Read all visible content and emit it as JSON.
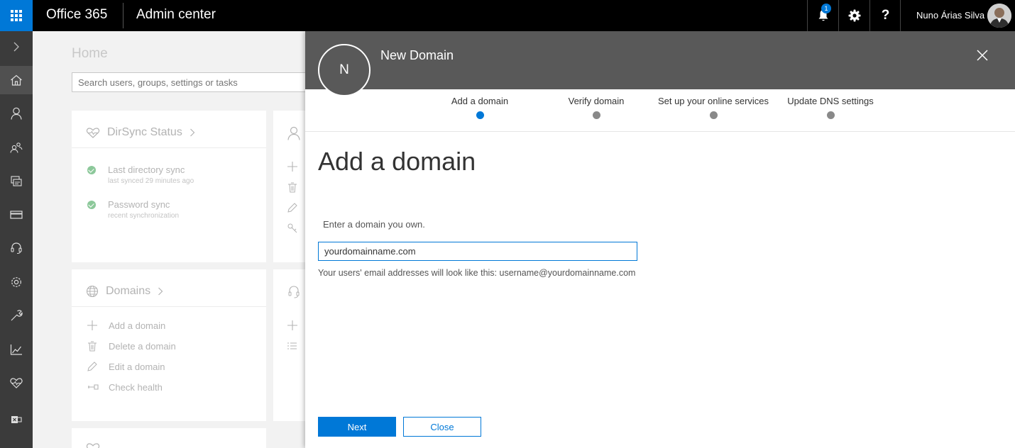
{
  "topbar": {
    "brand": "Office 365",
    "app_title": "Admin center",
    "notification_count": "1",
    "help_label": "?",
    "user_name": "Nuno Árias Silva"
  },
  "background": {
    "home_title": "Home",
    "search_placeholder": "Search users, groups, settings or tasks",
    "dirsync_card": {
      "title": "DirSync Status",
      "items": [
        {
          "label": "Last directory sync",
          "sub": "last synced 29 minutes ago"
        },
        {
          "label": "Password sync",
          "sub": "recent synchronization"
        }
      ]
    },
    "domains_card": {
      "title": "Domains",
      "actions": [
        "Add a domain",
        "Delete a domain",
        "Edit a domain",
        "Check health"
      ]
    }
  },
  "panel": {
    "avatar_letter": "N",
    "title": "New Domain",
    "steps": [
      {
        "label": "Add a domain",
        "active": true
      },
      {
        "label": "Verify domain",
        "active": false
      },
      {
        "label": "Set up your online services",
        "active": false
      },
      {
        "label": "Update DNS settings",
        "active": false
      }
    ],
    "heading": "Add a domain",
    "field_label": "Enter a domain you own.",
    "domain_value": "yourdomainname.com",
    "helper": "Your users' email addresses will look like this: username@yourdomainname.com",
    "next_label": "Next",
    "close_label": "Close"
  },
  "colors": {
    "accent": "#0078d7",
    "topbar": "#000000",
    "rail": "#3b3b3b",
    "panel_header": "#595959",
    "status_ok": "#8cc89a"
  },
  "icons": {
    "rail": [
      "chevron-right-icon",
      "home-icon",
      "user-icon",
      "groups-icon",
      "resources-icon",
      "billing-icon",
      "support-icon",
      "settings-icon",
      "setup-icon",
      "reports-icon",
      "health-icon",
      "admin-centers-icon"
    ]
  }
}
